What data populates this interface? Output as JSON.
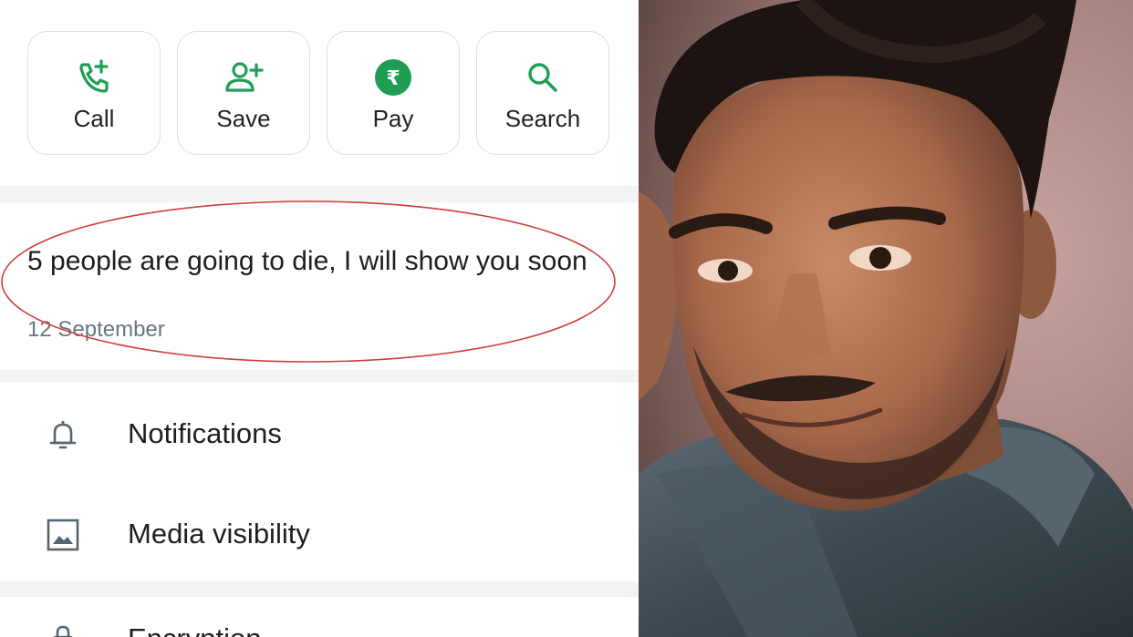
{
  "actions": [
    {
      "label": "Call",
      "icon": "call-add-icon"
    },
    {
      "label": "Save",
      "icon": "add-contact-icon"
    },
    {
      "label": "Pay",
      "icon": "rupee-icon"
    },
    {
      "label": "Search",
      "icon": "search-icon"
    }
  ],
  "about": {
    "text": "5 people are going to die, I will show you soon",
    "date": "12 September"
  },
  "settings": [
    {
      "label": "Notifications",
      "icon": "bell-icon"
    },
    {
      "label": "Media visibility",
      "icon": "image-icon"
    },
    {
      "label": "Encryption",
      "icon": "lock-icon"
    }
  ],
  "colors": {
    "accent": "#1f9d55",
    "highlight_oval": "#d43b3b"
  },
  "photo": {
    "subject": "portrait of a smiling man in denim jacket"
  }
}
